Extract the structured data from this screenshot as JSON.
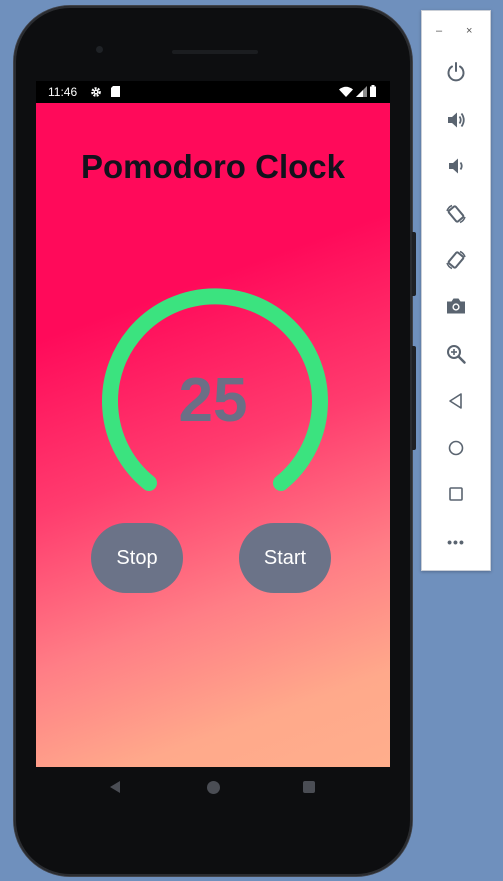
{
  "status_bar": {
    "time": "11:46",
    "icons": [
      "gear-icon",
      "sd-card-icon",
      "wifi-icon",
      "signal-icon",
      "battery-icon"
    ]
  },
  "app": {
    "title": "Pomodoro Clock",
    "timer_value": "25",
    "stop_label": "Stop",
    "start_label": "Start",
    "colors": {
      "gradient_top": "#ff0a5a",
      "gradient_bottom": "#ffae8c",
      "ring": "#3be37f",
      "buttons": "#6b7388",
      "timer_text": "#6b6f86",
      "title_text": "#12121c"
    }
  },
  "nav_bar": {
    "icons": [
      "back-icon",
      "home-icon",
      "recents-icon"
    ]
  },
  "emulator_sidebar": {
    "minimize_label": "–",
    "close_label": "×",
    "more_label": "•••",
    "icons": [
      "power-icon",
      "volume-up-icon",
      "volume-down-icon",
      "rotate-left-icon",
      "rotate-right-icon",
      "camera-icon",
      "zoom-icon",
      "back-icon",
      "home-icon",
      "overview-icon",
      "more-icon"
    ]
  }
}
